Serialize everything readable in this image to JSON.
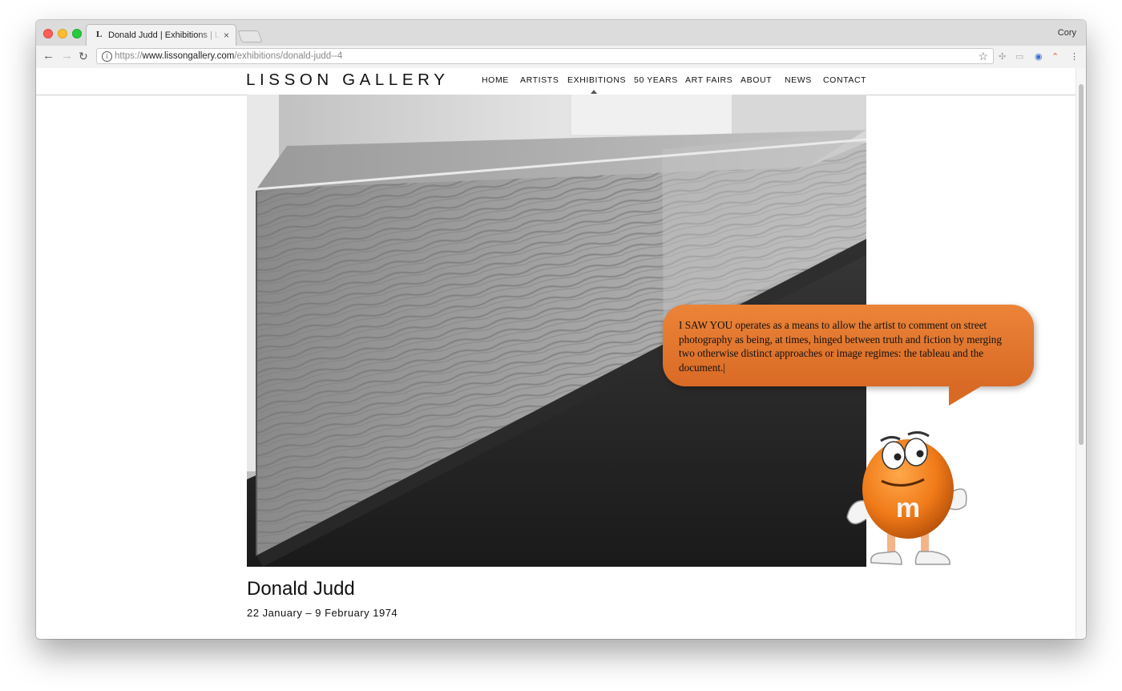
{
  "browser": {
    "tab_favicon": "L",
    "tab_title": "Donald Judd | Exhibitions | Lisson Gallery",
    "tab_close": "×",
    "profile": "Cory",
    "url_scheme": "https://",
    "url_host": "www.lissongallery.com",
    "url_path": "/exhibitions/donald-judd--4",
    "info_icon": "i",
    "icons": [
      "back-arrow-icon",
      "forward-arrow-icon",
      "reload-icon",
      "info-icon",
      "star-icon"
    ]
  },
  "site": {
    "logo": "LISSON GALLERY",
    "nav": [
      "HOME",
      "ARTISTS",
      "EXHIBITIONS",
      "50 YEARS",
      "ART FAIRS",
      "ABOUT",
      "NEWS",
      "CONTACT"
    ],
    "active_nav": "EXHIBITIONS"
  },
  "exhibition": {
    "title": "Donald Judd",
    "dates": "22 January – 9 February 1974"
  },
  "overlay": {
    "bubble_text": "I SAW YOU operates as a means to allow the artist to comment on street photography as being, at times, hinged between truth and fiction by merging two otherwise distinct approaches or image regimes: the tableau and the document.|",
    "mascot_mark": "m",
    "bubble_color": "#e2762e"
  }
}
